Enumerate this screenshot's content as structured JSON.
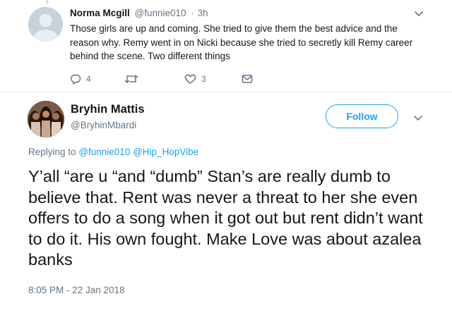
{
  "reply_tweet": {
    "author_name": "Norma Mcgill",
    "author_handle": "@funnie010",
    "separator": "·",
    "time_ago": "3h",
    "text": "Those girls are up and coming. She tried to give them the best advice and the reason why. Remy went in on Nicki because she tried to secretly kill Remy career behind the scene. Two different things",
    "reply_count": "4",
    "like_count": "3",
    "icons": [
      "reply-icon",
      "retweet-icon",
      "like-icon",
      "direct-message-icon",
      "chevron-down-icon"
    ]
  },
  "main_tweet": {
    "author_name": "Bryhin Mattis",
    "author_handle": "@BryhinMbardi",
    "follow_label": "Follow",
    "replying_to_label": "Replying to",
    "replying_to_handles": [
      "@funnie010",
      "@Hip_HopVibe"
    ],
    "text": "Y’all “are u “and “dumb” Stan’s are really dumb to believe that. Rent was never a threat to her she even offers to do a song when it got out but rent didn’t want to do it. His own fought. Make Love was about azalea banks",
    "timestamp": "8:05 PM - 22 Jan 2018"
  },
  "colors": {
    "accent": "#1da1f2",
    "text_primary": "#14171a",
    "text_secondary": "#657786",
    "divider": "#e6ecf0"
  }
}
